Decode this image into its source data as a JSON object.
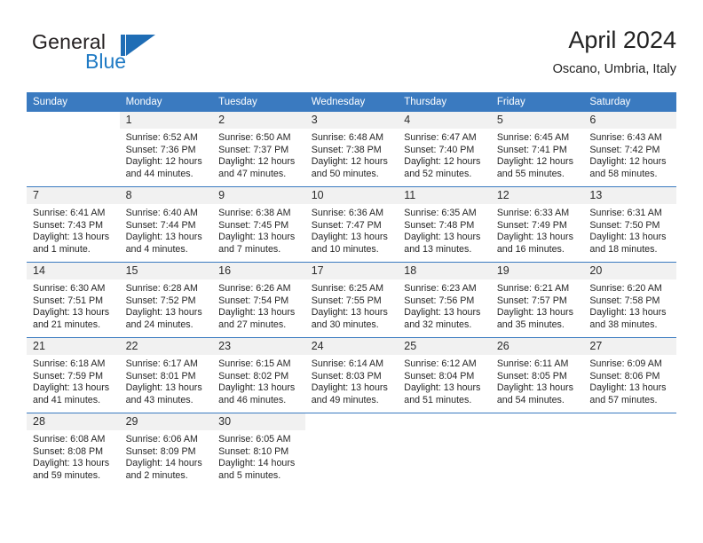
{
  "brand": {
    "name_part1": "General",
    "name_part2": "Blue",
    "mark": "triangle-flag"
  },
  "header": {
    "title": "April 2024",
    "location": "Oscano, Umbria, Italy"
  },
  "weekday_headers": [
    "Sunday",
    "Monday",
    "Tuesday",
    "Wednesday",
    "Thursday",
    "Friday",
    "Saturday"
  ],
  "colors": {
    "header_blue": "#3a7ac0",
    "daynum_band": "#f1f1f1",
    "logo_blue": "#1f7ac4",
    "text": "#262626"
  },
  "weeks": [
    [
      {
        "blank": true
      },
      {
        "day": "1",
        "sunrise": "Sunrise: 6:52 AM",
        "sunset": "Sunset: 7:36 PM",
        "daylight_line1": "Daylight: 12 hours",
        "daylight_line2": "and 44 minutes."
      },
      {
        "day": "2",
        "sunrise": "Sunrise: 6:50 AM",
        "sunset": "Sunset: 7:37 PM",
        "daylight_line1": "Daylight: 12 hours",
        "daylight_line2": "and 47 minutes."
      },
      {
        "day": "3",
        "sunrise": "Sunrise: 6:48 AM",
        "sunset": "Sunset: 7:38 PM",
        "daylight_line1": "Daylight: 12 hours",
        "daylight_line2": "and 50 minutes."
      },
      {
        "day": "4",
        "sunrise": "Sunrise: 6:47 AM",
        "sunset": "Sunset: 7:40 PM",
        "daylight_line1": "Daylight: 12 hours",
        "daylight_line2": "and 52 minutes."
      },
      {
        "day": "5",
        "sunrise": "Sunrise: 6:45 AM",
        "sunset": "Sunset: 7:41 PM",
        "daylight_line1": "Daylight: 12 hours",
        "daylight_line2": "and 55 minutes."
      },
      {
        "day": "6",
        "sunrise": "Sunrise: 6:43 AM",
        "sunset": "Sunset: 7:42 PM",
        "daylight_line1": "Daylight: 12 hours",
        "daylight_line2": "and 58 minutes."
      }
    ],
    [
      {
        "day": "7",
        "sunrise": "Sunrise: 6:41 AM",
        "sunset": "Sunset: 7:43 PM",
        "daylight_line1": "Daylight: 13 hours",
        "daylight_line2": "and 1 minute."
      },
      {
        "day": "8",
        "sunrise": "Sunrise: 6:40 AM",
        "sunset": "Sunset: 7:44 PM",
        "daylight_line1": "Daylight: 13 hours",
        "daylight_line2": "and 4 minutes."
      },
      {
        "day": "9",
        "sunrise": "Sunrise: 6:38 AM",
        "sunset": "Sunset: 7:45 PM",
        "daylight_line1": "Daylight: 13 hours",
        "daylight_line2": "and 7 minutes."
      },
      {
        "day": "10",
        "sunrise": "Sunrise: 6:36 AM",
        "sunset": "Sunset: 7:47 PM",
        "daylight_line1": "Daylight: 13 hours",
        "daylight_line2": "and 10 minutes."
      },
      {
        "day": "11",
        "sunrise": "Sunrise: 6:35 AM",
        "sunset": "Sunset: 7:48 PM",
        "daylight_line1": "Daylight: 13 hours",
        "daylight_line2": "and 13 minutes."
      },
      {
        "day": "12",
        "sunrise": "Sunrise: 6:33 AM",
        "sunset": "Sunset: 7:49 PM",
        "daylight_line1": "Daylight: 13 hours",
        "daylight_line2": "and 16 minutes."
      },
      {
        "day": "13",
        "sunrise": "Sunrise: 6:31 AM",
        "sunset": "Sunset: 7:50 PM",
        "daylight_line1": "Daylight: 13 hours",
        "daylight_line2": "and 18 minutes."
      }
    ],
    [
      {
        "day": "14",
        "sunrise": "Sunrise: 6:30 AM",
        "sunset": "Sunset: 7:51 PM",
        "daylight_line1": "Daylight: 13 hours",
        "daylight_line2": "and 21 minutes."
      },
      {
        "day": "15",
        "sunrise": "Sunrise: 6:28 AM",
        "sunset": "Sunset: 7:52 PM",
        "daylight_line1": "Daylight: 13 hours",
        "daylight_line2": "and 24 minutes."
      },
      {
        "day": "16",
        "sunrise": "Sunrise: 6:26 AM",
        "sunset": "Sunset: 7:54 PM",
        "daylight_line1": "Daylight: 13 hours",
        "daylight_line2": "and 27 minutes."
      },
      {
        "day": "17",
        "sunrise": "Sunrise: 6:25 AM",
        "sunset": "Sunset: 7:55 PM",
        "daylight_line1": "Daylight: 13 hours",
        "daylight_line2": "and 30 minutes."
      },
      {
        "day": "18",
        "sunrise": "Sunrise: 6:23 AM",
        "sunset": "Sunset: 7:56 PM",
        "daylight_line1": "Daylight: 13 hours",
        "daylight_line2": "and 32 minutes."
      },
      {
        "day": "19",
        "sunrise": "Sunrise: 6:21 AM",
        "sunset": "Sunset: 7:57 PM",
        "daylight_line1": "Daylight: 13 hours",
        "daylight_line2": "and 35 minutes."
      },
      {
        "day": "20",
        "sunrise": "Sunrise: 6:20 AM",
        "sunset": "Sunset: 7:58 PM",
        "daylight_line1": "Daylight: 13 hours",
        "daylight_line2": "and 38 minutes."
      }
    ],
    [
      {
        "day": "21",
        "sunrise": "Sunrise: 6:18 AM",
        "sunset": "Sunset: 7:59 PM",
        "daylight_line1": "Daylight: 13 hours",
        "daylight_line2": "and 41 minutes."
      },
      {
        "day": "22",
        "sunrise": "Sunrise: 6:17 AM",
        "sunset": "Sunset: 8:01 PM",
        "daylight_line1": "Daylight: 13 hours",
        "daylight_line2": "and 43 minutes."
      },
      {
        "day": "23",
        "sunrise": "Sunrise: 6:15 AM",
        "sunset": "Sunset: 8:02 PM",
        "daylight_line1": "Daylight: 13 hours",
        "daylight_line2": "and 46 minutes."
      },
      {
        "day": "24",
        "sunrise": "Sunrise: 6:14 AM",
        "sunset": "Sunset: 8:03 PM",
        "daylight_line1": "Daylight: 13 hours",
        "daylight_line2": "and 49 minutes."
      },
      {
        "day": "25",
        "sunrise": "Sunrise: 6:12 AM",
        "sunset": "Sunset: 8:04 PM",
        "daylight_line1": "Daylight: 13 hours",
        "daylight_line2": "and 51 minutes."
      },
      {
        "day": "26",
        "sunrise": "Sunrise: 6:11 AM",
        "sunset": "Sunset: 8:05 PM",
        "daylight_line1": "Daylight: 13 hours",
        "daylight_line2": "and 54 minutes."
      },
      {
        "day": "27",
        "sunrise": "Sunrise: 6:09 AM",
        "sunset": "Sunset: 8:06 PM",
        "daylight_line1": "Daylight: 13 hours",
        "daylight_line2": "and 57 minutes."
      }
    ],
    [
      {
        "day": "28",
        "sunrise": "Sunrise: 6:08 AM",
        "sunset": "Sunset: 8:08 PM",
        "daylight_line1": "Daylight: 13 hours",
        "daylight_line2": "and 59 minutes."
      },
      {
        "day": "29",
        "sunrise": "Sunrise: 6:06 AM",
        "sunset": "Sunset: 8:09 PM",
        "daylight_line1": "Daylight: 14 hours",
        "daylight_line2": "and 2 minutes."
      },
      {
        "day": "30",
        "sunrise": "Sunrise: 6:05 AM",
        "sunset": "Sunset: 8:10 PM",
        "daylight_line1": "Daylight: 14 hours",
        "daylight_line2": "and 5 minutes."
      },
      {
        "blank": true
      },
      {
        "blank": true
      },
      {
        "blank": true
      },
      {
        "blank": true
      }
    ]
  ]
}
